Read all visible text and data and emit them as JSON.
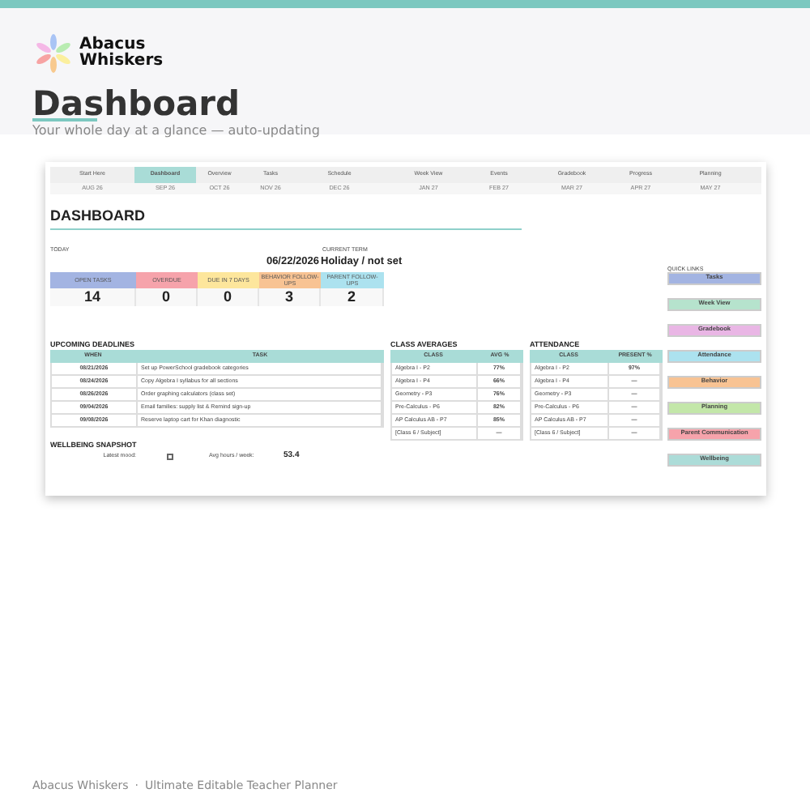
{
  "brand": {
    "line_1": "Abacus",
    "line_2": "Whiskers"
  },
  "page": {
    "title": "Dashboard",
    "subtitle": "Your whole day at a glance — auto-updating"
  },
  "tabs": [
    {
      "label": "Start Here",
      "month": "AUG 26",
      "selected": false
    },
    {
      "label": "Dashboard",
      "month": "SEP 26",
      "selected": true
    },
    {
      "label": "Overview",
      "month": "OCT 26",
      "selected": false
    },
    {
      "label": "Tasks",
      "month": "NOV 26",
      "selected": false
    },
    {
      "label": "Schedule",
      "month": "DEC 26",
      "selected": false
    },
    {
      "label": "Week View",
      "month": "JAN 27",
      "selected": false
    },
    {
      "label": "Events",
      "month": "FEB 27",
      "selected": false
    },
    {
      "label": "Gradebook",
      "month": "MAR 27",
      "selected": false
    },
    {
      "label": "Progress",
      "month": "APR 27",
      "selected": false
    },
    {
      "label": "Planning",
      "month": "MAY 27",
      "selected": false
    }
  ],
  "sheet": {
    "heading": "DASHBOARD",
    "today_label": "TODAY",
    "term_label": "CURRENT TERM",
    "today_value": "06/22/2026",
    "term_value": "Holiday / not set"
  },
  "stats": [
    {
      "label": "OPEN TASKS",
      "value": "14",
      "color": "#a3b4e2"
    },
    {
      "label": "OVERDUE",
      "value": "0",
      "color": "#f6a3ab"
    },
    {
      "label": "DUE IN 7 DAYS",
      "value": "0",
      "color": "#fde69c"
    },
    {
      "label": "BEHAVIOR FOLLOW-UPS",
      "value": "3",
      "color": "#f8c393"
    },
    {
      "label": "PARENT FOLLOW-UPS",
      "value": "2",
      "color": "#ace2ef"
    }
  ],
  "deadlines": {
    "title": "UPCOMING DEADLINES",
    "columns": [
      "WHEN",
      "TASK"
    ],
    "rows": [
      [
        "08/21/2026",
        "Set up PowerSchool gradebook categories"
      ],
      [
        "08/24/2026",
        "Copy Algebra I syllabus for all sections"
      ],
      [
        "08/26/2026",
        "Order graphing calculators (class set)"
      ],
      [
        "09/04/2026",
        "Email families: supply list & Remind sign-up"
      ],
      [
        "09/08/2026",
        "Reserve laptop cart for Khan diagnostic"
      ]
    ]
  },
  "class_averages": {
    "title": "CLASS AVERAGES",
    "columns": [
      "CLASS",
      "AVG %"
    ],
    "rows": [
      [
        "Algebra I - P2",
        "77%"
      ],
      [
        "Algebra I - P4",
        "66%"
      ],
      [
        "Geometry - P3",
        "76%"
      ],
      [
        "Pre-Calculus - P6",
        "82%"
      ],
      [
        "AP Calculus AB - P7",
        "85%"
      ],
      [
        "[Class 6 / Subject]",
        "—"
      ]
    ]
  },
  "attendance": {
    "title": "ATTENDANCE",
    "columns": [
      "CLASS",
      "PRESENT %"
    ],
    "rows": [
      [
        "Algebra I - P2",
        "97%"
      ],
      [
        "Algebra I - P4",
        "—"
      ],
      [
        "Geometry - P3",
        "—"
      ],
      [
        "Pre-Calculus - P6",
        "—"
      ],
      [
        "AP Calculus AB - P7",
        "—"
      ],
      [
        "[Class 6 / Subject]",
        "—"
      ]
    ]
  },
  "quick_links": {
    "title": "QUICK LINKS",
    "items": [
      {
        "label": "Tasks",
        "color": "#a3b4e2"
      },
      {
        "label": "Week View",
        "color": "#b6e3cd"
      },
      {
        "label": "Gradebook",
        "color": "#e9b6e5"
      },
      {
        "label": "Attendance",
        "color": "#ace2ef"
      },
      {
        "label": "Behavior",
        "color": "#f8c393"
      },
      {
        "label": "Planning",
        "color": "#c3e7a9"
      },
      {
        "label": "Parent Communication",
        "color": "#f6a3ab"
      },
      {
        "label": "Wellbeing",
        "color": "#acdcd8"
      }
    ]
  },
  "wellbeing": {
    "title": "WELLBEING SNAPSHOT",
    "mood_label": "Latest mood:",
    "mood_checked": false,
    "hours_label": "Avg hours / week:",
    "hours_value": "53.4"
  },
  "footer": {
    "brand": "Abacus Whiskers",
    "separator": "·",
    "tagline": "Ultimate Editable Teacher Planner"
  }
}
